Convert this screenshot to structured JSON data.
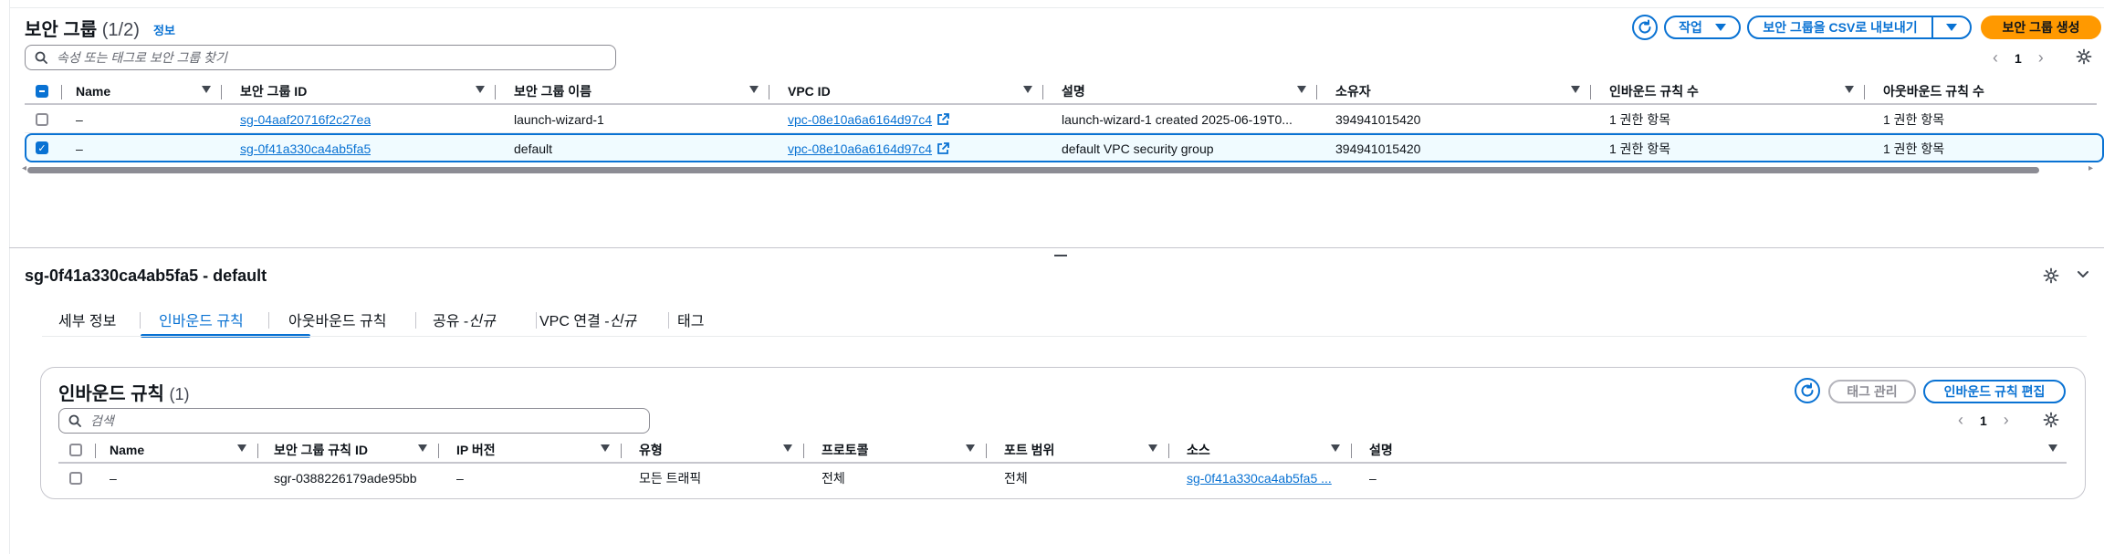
{
  "top_panel": {
    "title": "보안 그룹",
    "count": "(1/2)",
    "info_link": "정보",
    "actions_label": "작업",
    "export_label": "보안 그룹을 CSV로 내보내기",
    "create_label": "보안 그룹 생성",
    "search_placeholder": "속성 또는 태그로 보안 그룹 찾기",
    "page_number": "1",
    "columns": [
      "Name",
      "보안 그룹 ID",
      "보안 그룹 이름",
      "VPC ID",
      "설명",
      "소유자",
      "인바운드 규칙 수",
      "아웃바운드 규칙 수"
    ],
    "rows": [
      {
        "name": "–",
        "sg_id": "sg-04aaf20716f2c27ea",
        "sg_name": "launch-wizard-1",
        "vpc_id": "vpc-08e10a6a6164d97c4",
        "description": "launch-wizard-1 created 2025-06-19T0...",
        "owner": "394941015420",
        "inbound": "1 권한 항목",
        "outbound": "1 권한 항목",
        "selected": false
      },
      {
        "name": "–",
        "sg_id": "sg-0f41a330ca4ab5fa5",
        "sg_name": "default",
        "vpc_id": "vpc-08e10a6a6164d97c4",
        "description": "default VPC security group",
        "owner": "394941015420",
        "inbound": "1 권한 항목",
        "outbound": "1 권한 항목",
        "selected": true
      }
    ]
  },
  "detail_panel": {
    "title": "sg-0f41a330ca4ab5fa5 - default",
    "tabs": [
      {
        "label": "세부 정보",
        "suffix": ""
      },
      {
        "label": "인바운드 규칙",
        "suffix": ""
      },
      {
        "label": "아웃바운드 규칙",
        "suffix": ""
      },
      {
        "label": "공유 - ",
        "suffix": "신규"
      },
      {
        "label": "VPC 연결 - ",
        "suffix": "신규"
      },
      {
        "label": "태그",
        "suffix": ""
      }
    ],
    "active_tab": "인바운드 규칙",
    "inbound": {
      "title": "인바운드 규칙",
      "count": "(1)",
      "manage_tags_label": "태그 관리",
      "edit_label": "인바운드 규칙 편집",
      "search_placeholder": "검색",
      "page_number": "1",
      "columns": [
        "Name",
        "보안 그룹 규칙 ID",
        "IP 버전",
        "유형",
        "프로토콜",
        "포트 범위",
        "소스",
        "설명"
      ],
      "rows": [
        {
          "name": "–",
          "rule_id": "sgr-0388226179ade95bb",
          "ip_version": "–",
          "type": "모든 트래픽",
          "protocol": "전체",
          "port_range": "전체",
          "source": "sg-0f41a330ca4ab5fa5 ...",
          "description": "–"
        }
      ]
    }
  },
  "colors": {
    "accent": "#0972d3",
    "primary_button": "#ff9900",
    "border": "#c6c6cd",
    "text": "#0f141a"
  }
}
